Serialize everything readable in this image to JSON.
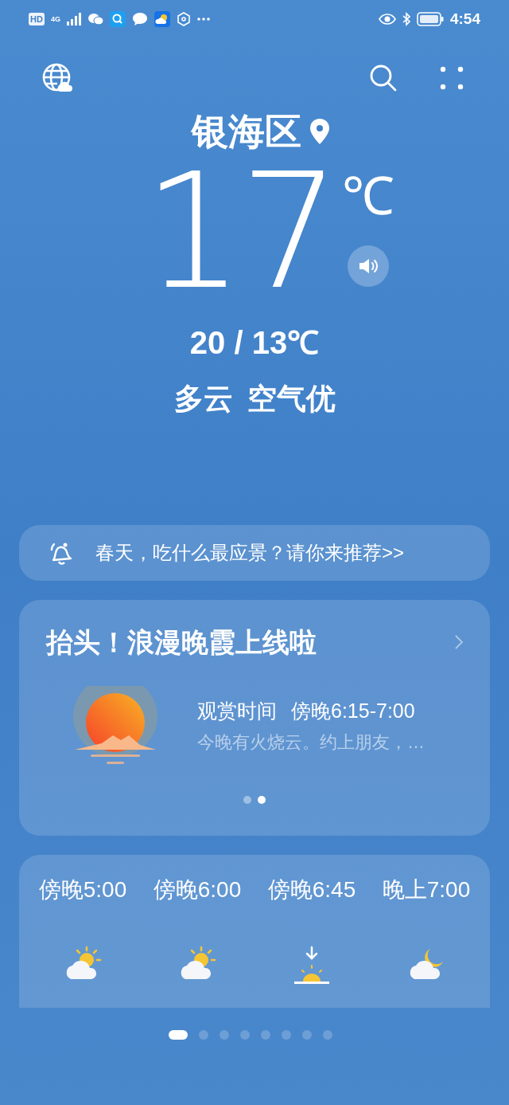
{
  "status_bar": {
    "badges": [
      "HD",
      "4G"
    ],
    "time": "4:54"
  },
  "location": {
    "name": "银海区"
  },
  "current": {
    "temperature": "17",
    "unit": "℃",
    "high_low": "20 / 13℃",
    "condition": "多云",
    "air_quality": "空气优"
  },
  "notice": {
    "text": "春天，吃什么最应景？请你来推荐>>"
  },
  "sunset_card": {
    "title": "抬头！浪漫晚霞上线啦",
    "viewing_label": "观赏时间",
    "viewing_time": "傍晚6:15-7:00",
    "description": "今晚有火烧云。约上朋友，…",
    "dots": [
      {
        "selected": false
      },
      {
        "selected": true
      }
    ]
  },
  "hourly": [
    {
      "time": "傍晚5:00",
      "kind": "partly_cloudy_day"
    },
    {
      "time": "傍晚6:00",
      "kind": "partly_cloudy_day"
    },
    {
      "time": "傍晚6:45",
      "kind": "sunset"
    },
    {
      "time": "晚上7:00",
      "kind": "partly_cloudy_night"
    }
  ],
  "pages": [
    {
      "selected": true
    },
    {
      "selected": false
    },
    {
      "selected": false
    },
    {
      "selected": false
    },
    {
      "selected": false
    },
    {
      "selected": false
    },
    {
      "selected": false
    },
    {
      "selected": false
    }
  ]
}
